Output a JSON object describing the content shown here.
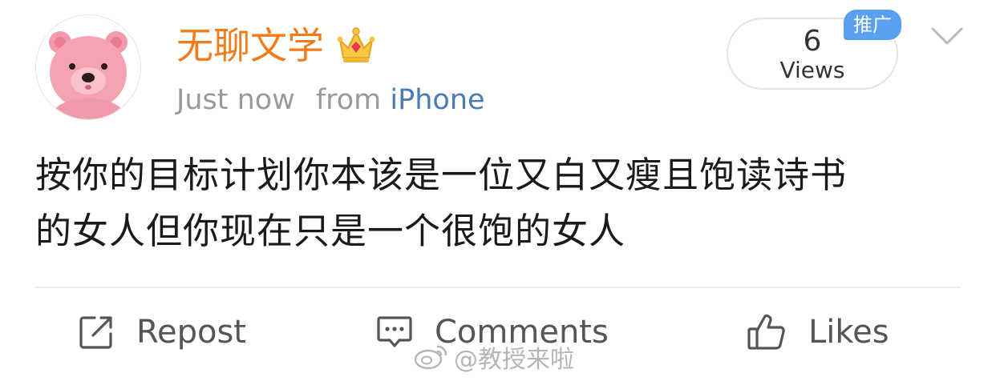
{
  "post": {
    "username": "无聊文学",
    "timestamp": "Just now",
    "source_prefix": "from",
    "source_device": "iPhone",
    "body_line_1": "按你的目标计划你本该是一位又白又瘦且饱读诗书",
    "body_line_2": "的女人但你现在只是一个很饱的女人",
    "views_count": "6",
    "views_label": "Views",
    "promo_badge": "推广"
  },
  "actions": {
    "repost_label": "Repost",
    "comments_label": "Comments",
    "likes_label": "Likes"
  },
  "watermark": {
    "text": "@教授来啦"
  },
  "icons": {
    "avatar": "pink-bear-avatar",
    "verified": "crown-icon",
    "menu": "chevron-down-icon",
    "repost": "repost-icon",
    "comments": "comment-icon",
    "likes": "thumbs-up-icon",
    "watermark_logo": "weibo-logo-icon"
  },
  "colors": {
    "username": "#f07c1c",
    "source_link": "#4a7cb3",
    "meta_text": "#9a9a9a",
    "promo_badge": "#5aa0f0",
    "body_text": "#1a1a1a",
    "action_text": "#555555"
  }
}
